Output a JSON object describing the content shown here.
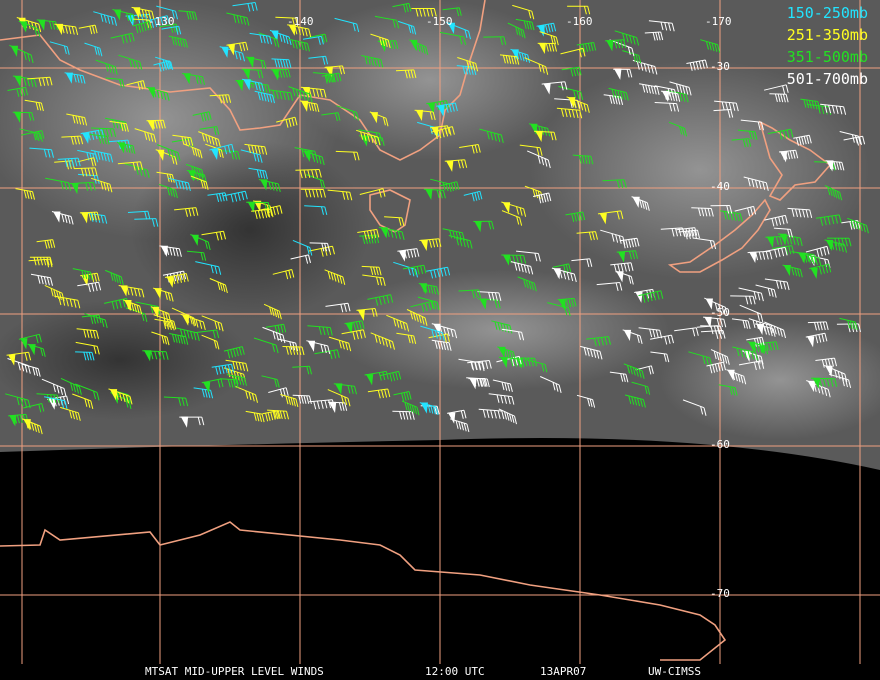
{
  "meridians": [
    {
      "label": "-130"
    },
    {
      "label": "-140"
    },
    {
      "label": "-150"
    },
    {
      "label": "-160"
    },
    {
      "label": "-170"
    }
  ],
  "parallels": [
    {
      "label": "-30"
    },
    {
      "label": "-40"
    },
    {
      "label": "-50"
    },
    {
      "label": "-60"
    },
    {
      "label": "-70"
    }
  ],
  "legend": [
    {
      "label": "150-250mb",
      "color": "#22e4ff"
    },
    {
      "label": "251-350mb",
      "color": "#ffff22"
    },
    {
      "label": "351-500mb",
      "color": "#22e022"
    },
    {
      "label": "501-700mb",
      "color": "#ffffff"
    }
  ],
  "caption": {
    "product": "MTSAT MID-UPPER LEVEL WINDS",
    "time": "12:00 UTC",
    "date": "13APR07",
    "source": "UW-CIMSS"
  },
  "colors": {
    "grid": "#f0a080",
    "coast": "#f0a080",
    "earth": "#5a5a5a",
    "space": "#000000"
  }
}
